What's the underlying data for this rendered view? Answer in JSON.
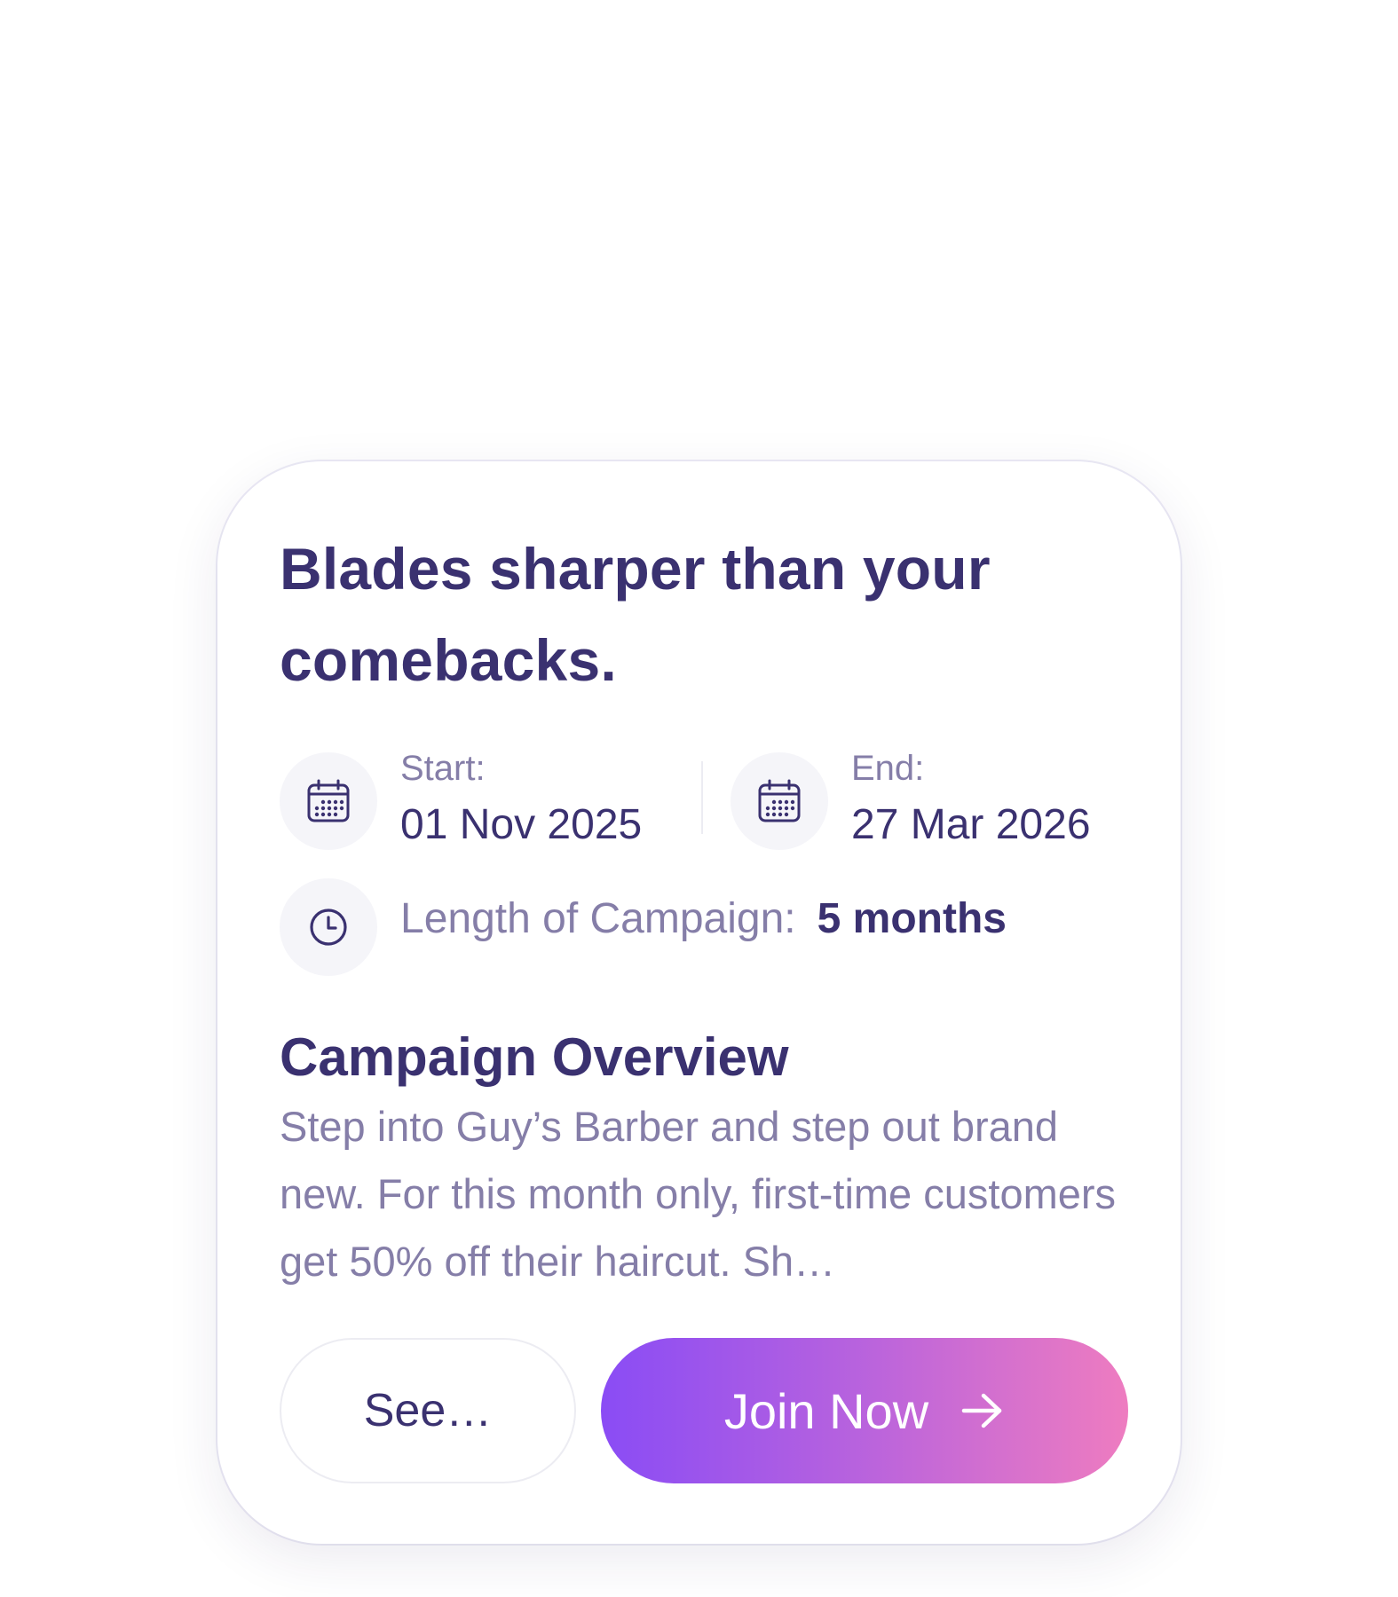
{
  "campaign": {
    "title": "Blades sharper than your comebacks.",
    "start": {
      "label": "Start:",
      "value": "01 Nov 2025",
      "icon": "calendar-icon"
    },
    "end": {
      "label": "End:",
      "value": "27 Mar 2026",
      "icon": "calendar-icon"
    },
    "length": {
      "label": "Length of Campaign:",
      "value": "5 months",
      "icon": "clock-icon"
    },
    "overview": {
      "heading": "Campaign Overview",
      "text": "Step into Guy’s Barber and step out brand new. For this month only, first-time customers get 50% off their haircut. Sh…"
    }
  },
  "actions": {
    "see_label": "See…",
    "join_label": "Join Now",
    "join_icon": "arrow-right-icon"
  },
  "colors": {
    "primary_text": "#3a3170",
    "muted_text": "#857ea8",
    "icon_bg": "#f5f5f9",
    "gradient_start": "#8a4cf5",
    "gradient_end": "#ee7cc0"
  }
}
